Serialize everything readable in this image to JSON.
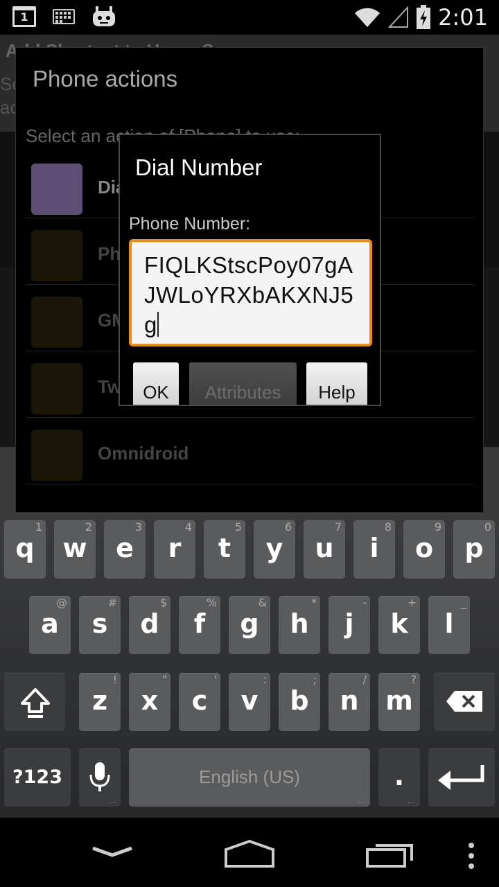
{
  "status_bar": {
    "calendar_day": "1",
    "time": "2:01",
    "icons": [
      "calendar-icon",
      "keyboard-icon",
      "cyanogen-icon",
      "wifi-icon",
      "signal-icon",
      "battery-charging-icon"
    ]
  },
  "background_app": {
    "title": "Add Shortcut to Home Screen",
    "desc_line1": "Sc",
    "desc_line2": "ac"
  },
  "actions_dialog": {
    "title": "Phone actions",
    "subtitle": "Select an action of [Phone] to use:",
    "items": [
      {
        "label": "Dial Number"
      },
      {
        "label": "Ph"
      },
      {
        "label": "GM"
      },
      {
        "label": "Tw"
      },
      {
        "label": "Omnidroid"
      }
    ]
  },
  "dial_dialog": {
    "title": "Dial Number",
    "field_label": "Phone Number:",
    "field_value": "FIQLKStscPoy07gAJWLoYRXbAKXNJ5g",
    "ok_label": "OK",
    "attributes_label": "Attributes",
    "help_label": "Help"
  },
  "keyboard": {
    "row1": [
      {
        "key": "q",
        "hint": "1"
      },
      {
        "key": "w",
        "hint": "2"
      },
      {
        "key": "e",
        "hint": "3"
      },
      {
        "key": "r",
        "hint": "4"
      },
      {
        "key": "t",
        "hint": "5"
      },
      {
        "key": "y",
        "hint": "6"
      },
      {
        "key": "u",
        "hint": "7"
      },
      {
        "key": "i",
        "hint": "8"
      },
      {
        "key": "o",
        "hint": "9"
      },
      {
        "key": "p",
        "hint": "0"
      }
    ],
    "row2": [
      {
        "key": "a",
        "hint": "@"
      },
      {
        "key": "s",
        "hint": "#"
      },
      {
        "key": "d",
        "hint": "$"
      },
      {
        "key": "f",
        "hint": "%"
      },
      {
        "key": "g",
        "hint": "&"
      },
      {
        "key": "h",
        "hint": "*"
      },
      {
        "key": "j",
        "hint": "-"
      },
      {
        "key": "k",
        "hint": "+"
      },
      {
        "key": "l",
        "hint": "_"
      }
    ],
    "row3": [
      {
        "key": "z",
        "hint": "!"
      },
      {
        "key": "x",
        "hint": "\""
      },
      {
        "key": "c",
        "hint": "'"
      },
      {
        "key": "v",
        "hint": ":"
      },
      {
        "key": "b",
        "hint": ";"
      },
      {
        "key": "n",
        "hint": "/"
      },
      {
        "key": "m",
        "hint": "?"
      }
    ],
    "symbols_label": "?123",
    "space_label": "English (US)",
    "period_label": "."
  },
  "nav_bar": {
    "icons": [
      "back-icon",
      "home-icon",
      "recents-icon",
      "menu-icon"
    ]
  }
}
